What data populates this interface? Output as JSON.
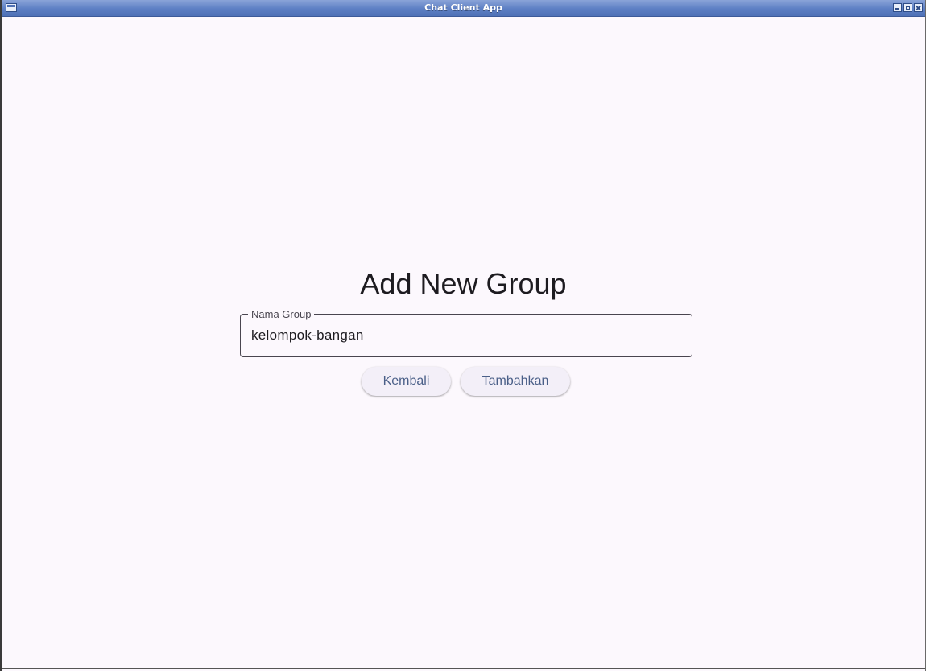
{
  "window": {
    "title": "Chat Client App",
    "background_color": "#fcf8fd",
    "titlebar_color": "#5d7fc4"
  },
  "page": {
    "title": "Add New Group"
  },
  "form": {
    "group_name": {
      "label": "Nama Group",
      "value": "kelompok-bangan"
    }
  },
  "actions": {
    "back_label": "Kembali",
    "add_label": "Tambahkan",
    "button_text_color": "#4a5f88",
    "button_bg_color": "#f3eff8"
  },
  "icons": {
    "system_menu": "window-menu-icon",
    "minimize": "minimize-icon",
    "maximize": "maximize-icon",
    "close": "close-icon"
  }
}
